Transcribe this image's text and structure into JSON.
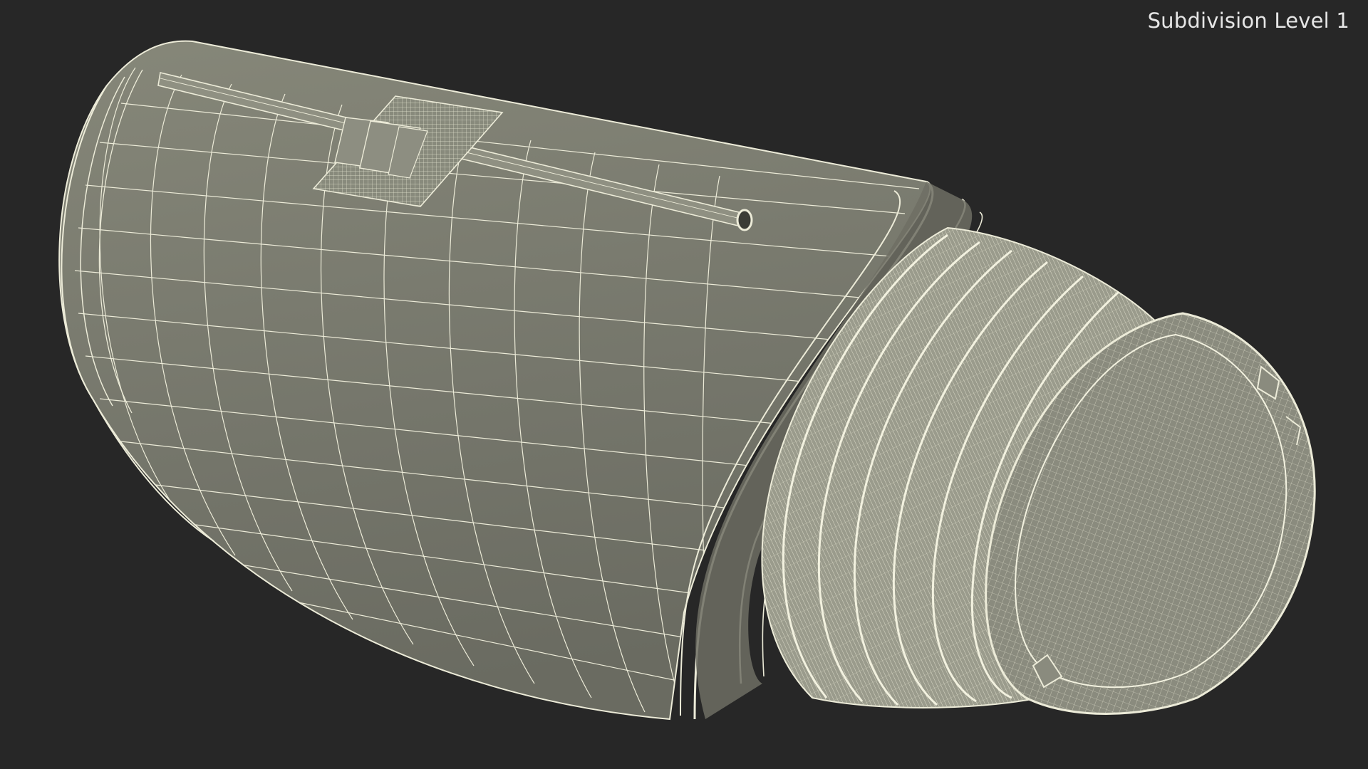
{
  "viewport": {
    "label": "Subdivision Level 1",
    "background_color": "#272727",
    "mesh_fill_color": "#7b7c70",
    "wire_color": "#ecebd8"
  }
}
